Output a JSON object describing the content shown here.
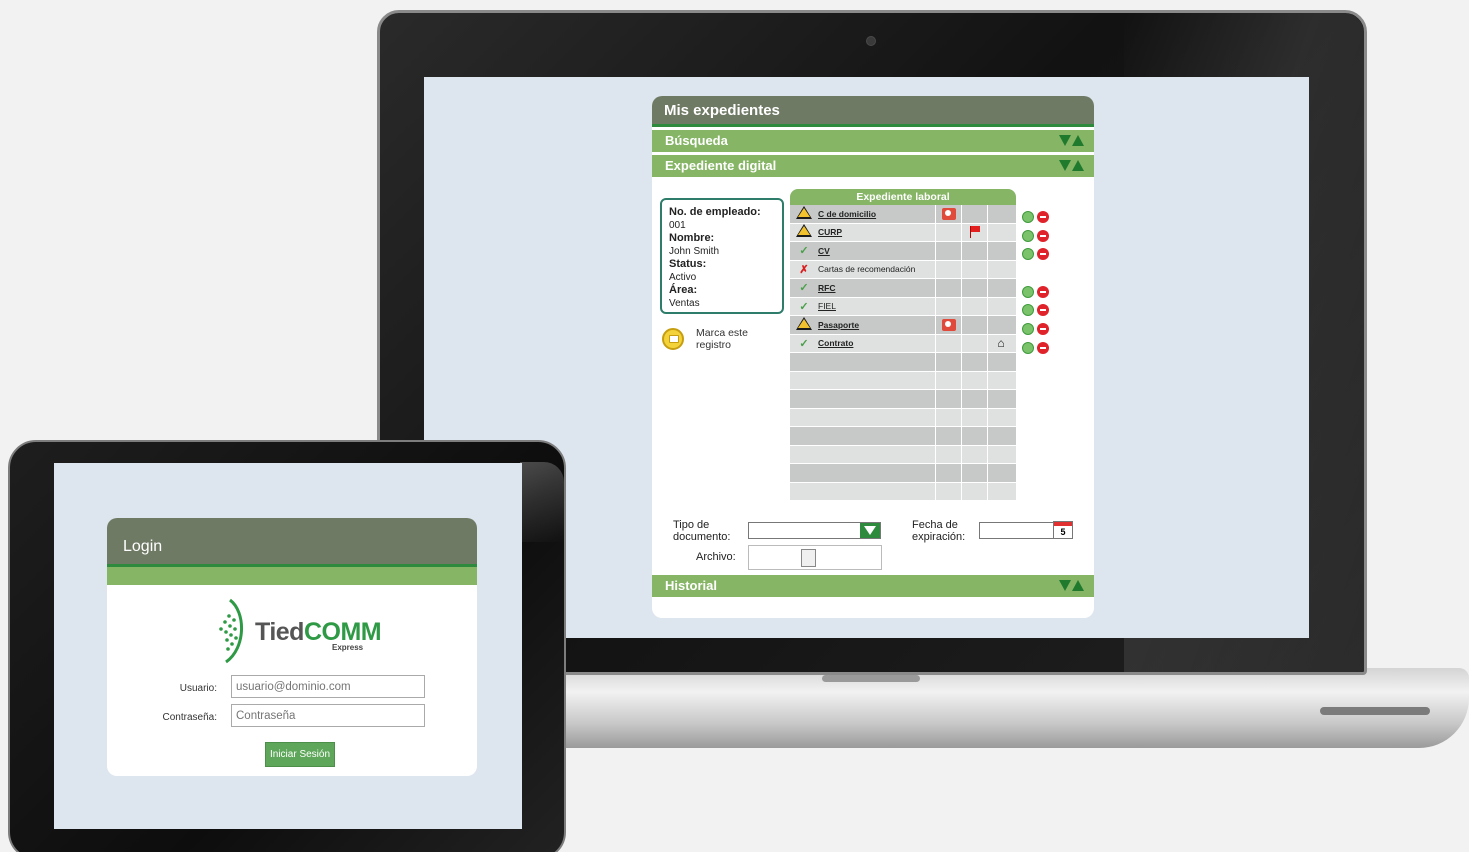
{
  "main_panel": {
    "title": "Mis expedientes",
    "sections": {
      "busqueda": "Búsqueda",
      "expediente_digital": "Expediente digital",
      "historial": "Historial"
    }
  },
  "employee": {
    "number_label": "No. de empleado:",
    "number": "001",
    "name_label": "Nombre:",
    "name": "John Smith",
    "status_label": "Status:",
    "status": "Activo",
    "area_label": "Área:",
    "area": "Ventas"
  },
  "mark_record": {
    "line1": "Marca este",
    "line2": "registro"
  },
  "table": {
    "title": "Expediente laboral",
    "rows": [
      {
        "name": "C de domicilio"
      },
      {
        "name": "CURP"
      },
      {
        "name": "CV"
      },
      {
        "name": "Cartas de recomendación"
      },
      {
        "name": "RFC"
      },
      {
        "name": "FIEL"
      },
      {
        "name": "Pasaporte"
      },
      {
        "name": "Contrato"
      }
    ]
  },
  "form": {
    "tipo_line1": "Tipo de",
    "tipo_line2": "documento:",
    "fecha_line1": "Fecha de",
    "fecha_line2": "expiración:",
    "calendar_day": "5",
    "archivo_label": "Archivo:"
  },
  "login": {
    "title": "Login",
    "brand_tied": "Tied",
    "brand_comm": "COMM",
    "brand_sub": "Express",
    "user_label": "Usuario:",
    "user_placeholder": "usuario@dominio.com",
    "pass_label": "Contraseña:",
    "pass_placeholder": "Contraseña",
    "submit": "Iniciar Sesión"
  },
  "colors": {
    "header": "#6f7a65",
    "section": "#86b565",
    "accent": "#2e8b3d"
  }
}
